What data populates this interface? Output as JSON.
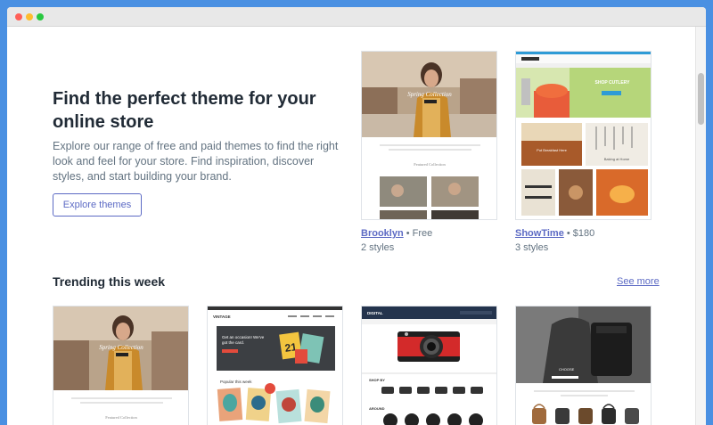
{
  "hero": {
    "title": "Find the perfect theme for your online store",
    "description": "Explore our range of free and paid themes to find the right look and feel for your store. Find inspiration, discover styles, and start building your brand.",
    "button_label": "Explore themes"
  },
  "featured": [
    {
      "name": "Brooklyn",
      "price": "Free",
      "styles": "2 styles"
    },
    {
      "name": "ShowTime",
      "price": "$180",
      "styles": "3 styles"
    }
  ],
  "trending": {
    "title": "Trending this week",
    "see_more": "See more"
  },
  "thumbs": {
    "brooklyn_banner": "Spring Collection",
    "brooklyn_featured": "Featured Collection",
    "showtime_banner": "SHOP CUTLERY",
    "showtime_tile1": "Put Breakfast Here",
    "showtime_tile2": "Baking at Home",
    "vintage_logo": "VINTAGE",
    "vintage_banner": "Get an occasion! We've got the card.",
    "vintage_popular": "Popular this week",
    "digital_logo": "DIGITAL",
    "digital_shop": "SHOP BY",
    "digital_new": "AROUND",
    "trend1_banner": "Spring Collection",
    "trend1_featured": "Featured Collection"
  },
  "colors": {
    "accent": "#5c6ac4",
    "heading": "#212b36",
    "body": "#637381",
    "frame": "#4a90e2"
  }
}
